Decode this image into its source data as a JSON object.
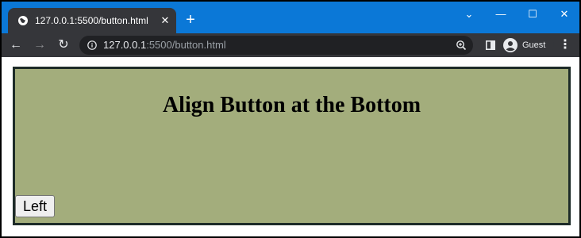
{
  "browser": {
    "tab": {
      "title": "127.0.0.1:5500/button.html",
      "close_glyph": "✕",
      "icon": "globe-icon"
    },
    "new_tab_glyph": "+",
    "window_controls": {
      "tab_search_glyph": "⌄",
      "minimize_glyph": "—",
      "maximize_glyph": "☐",
      "close_glyph": "✕"
    },
    "toolbar": {
      "back_glyph": "←",
      "forward_glyph": "→",
      "reload_glyph": "↻",
      "url_host": "127.0.0.1",
      "url_path": ":5500/button.html",
      "profile_label": "Guest",
      "menu_glyph": "⋮"
    },
    "colors": {
      "titlebar": "#0b78d7",
      "toolbar": "#35363a",
      "omnibox": "#202124"
    }
  },
  "page": {
    "heading": "Align Button at the Bottom",
    "button_label": "Left",
    "colors": {
      "box_background": "#a3ad7c",
      "box_border": "#1d2b28"
    }
  }
}
